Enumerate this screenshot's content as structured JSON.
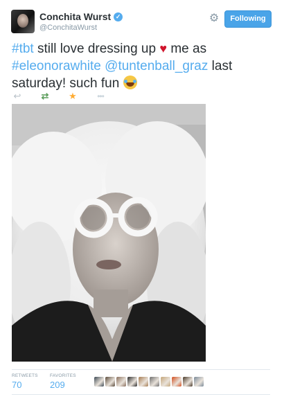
{
  "user": {
    "display_name": "Conchita Wurst",
    "handle": "@ConchitaWurst",
    "verified_glyph": "✓"
  },
  "follow_button": {
    "label": "Following"
  },
  "icons": {
    "gear": "⚙",
    "reply": "↩",
    "retweet": "⇄",
    "favorite": "★",
    "more": "•••",
    "heart": "♥"
  },
  "tweet": {
    "hashtag_tbt": "#tbt",
    "text_1": " still love dressing up ",
    "text_2": " me as ",
    "hashtag_eleonora": "#eleonorawhite",
    "mention": "@tuntenball_graz",
    "text_3": " last saturday! such fun "
  },
  "stats": {
    "retweets_label": "RETWEETS",
    "retweets_value": "70",
    "favorites_label": "FAVORITES",
    "favorites_value": "209"
  },
  "colors": {
    "link": "#55acee",
    "follow_bg": "#4aa4e8",
    "heart": "#d0142c",
    "favorite": "#ffac33",
    "retweet": "#5c9e5c"
  },
  "favoriter_avatars": [
    "#3d4a55",
    "#5a4a3a",
    "#8a6f5c",
    "#2b2b2b",
    "#a67c52",
    "#6e6e6e",
    "#c4a67a",
    "#d24d1c",
    "#4a3a2a",
    "#7a8a99"
  ]
}
